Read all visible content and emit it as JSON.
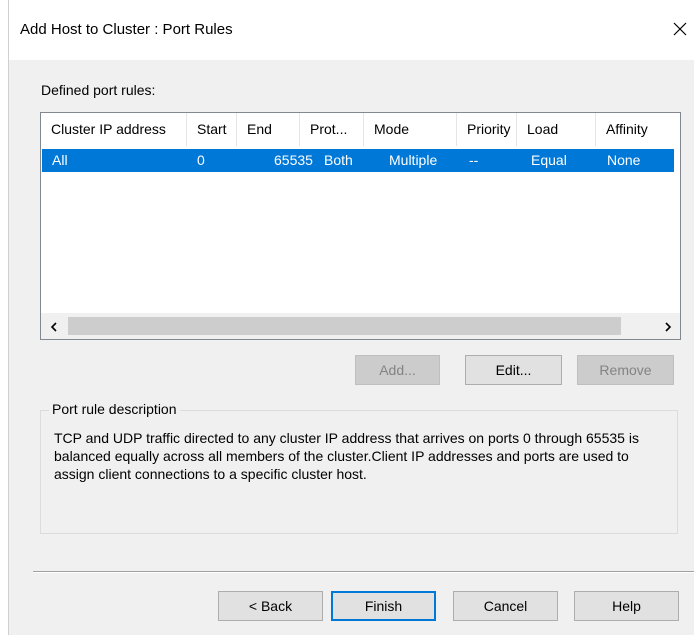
{
  "window": {
    "title": "Add Host to Cluster :  Port Rules"
  },
  "defined_label": "Defined port rules:",
  "port_rules": {
    "columns": [
      "Cluster IP address",
      "Start",
      "End",
      "Prot...",
      "Mode",
      "Priority",
      "Load",
      "Affinity"
    ],
    "rows": [
      [
        "All",
        "0",
        "65535",
        "Both",
        "Multiple",
        "--",
        "Equal",
        "None"
      ]
    ],
    "selected_row": 0
  },
  "buttons": {
    "add": "Add...",
    "edit": "Edit...",
    "remove": "Remove",
    "back": "< Back",
    "finish": "Finish",
    "cancel": "Cancel",
    "help": "Help"
  },
  "description": {
    "legend": "Port rule description",
    "text": "TCP and UDP traffic directed to any cluster IP address that arrives on ports 0 through 65535 is balanced equally across all members of the cluster.Client IP addresses and ports are used to assign client connections to a specific cluster host."
  },
  "colors": {
    "selection": "#0078d7",
    "dialog_bg": "#f0f0f0"
  },
  "icons": [
    "close-icon",
    "scroll-left-icon",
    "scroll-right-icon"
  ]
}
